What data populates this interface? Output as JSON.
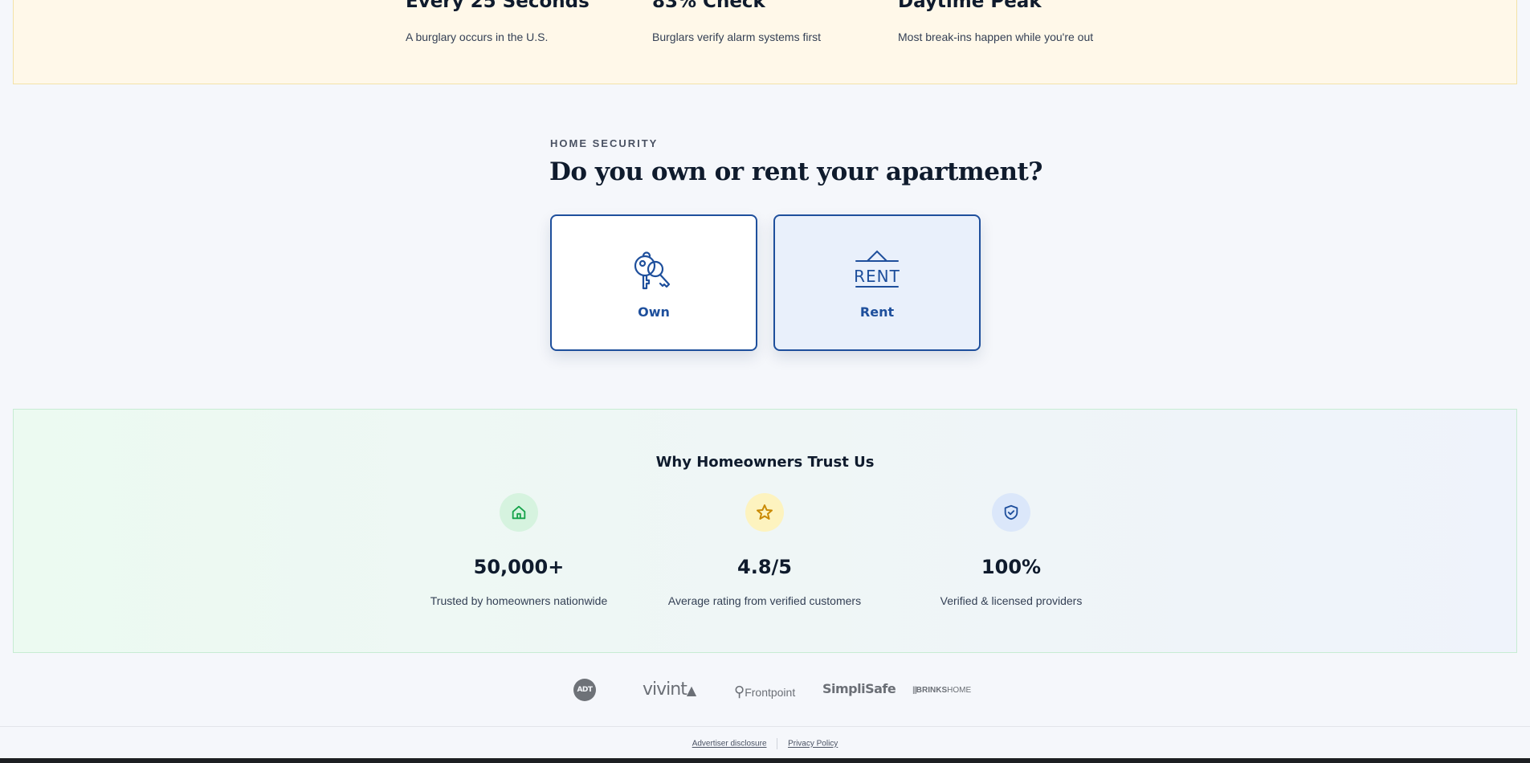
{
  "stats": [
    {
      "title": "Every 25 Seconds",
      "desc": "A burglary occurs in the U.S."
    },
    {
      "title": "83% Check",
      "desc": "Burglars verify alarm systems first"
    },
    {
      "title": "Daytime Peak",
      "desc": "Most break-ins happen while you're out"
    }
  ],
  "question": {
    "eyebrow": "HOME SECURITY",
    "heading": "Do you own or rent your apartment?",
    "options": [
      {
        "label": "Own",
        "icon": "keys-icon"
      },
      {
        "label": "Rent",
        "icon": "rent-sign-icon",
        "icon_text": "RENT",
        "selected": true
      }
    ]
  },
  "trust": {
    "title": "Why Homeowners Trust Us",
    "items": [
      {
        "value": "50,000+",
        "desc": "Trusted by homeowners nationwide",
        "icon": "home-icon",
        "color": "#16a34a"
      },
      {
        "value": "4.8/5",
        "desc": "Average rating from verified customers",
        "icon": "star-icon",
        "color": "#ca8a04"
      },
      {
        "value": "100%",
        "desc": "Verified & licensed providers",
        "icon": "shield-check-icon",
        "color": "#1e4f9c"
      }
    ]
  },
  "logos": [
    "ADT",
    "vivint",
    "Frontpoint",
    "SimpliSafe",
    "BRINKS",
    "HOME"
  ],
  "footer": {
    "advertiser": "Advertiser disclosure",
    "privacy": "Privacy Policy"
  }
}
